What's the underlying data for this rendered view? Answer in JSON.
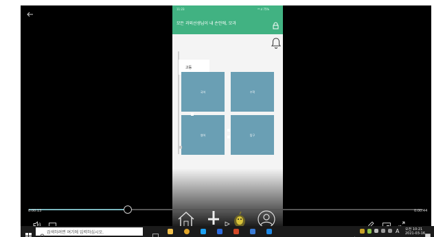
{
  "phone": {
    "status_time": "11:23",
    "status_right": "⁴ᴳ.ıl 75%",
    "header_title": "모든 과외선생님이 내 손안에, 모과",
    "tab_label": "고등",
    "tiles": [
      "국어",
      "수학",
      "영어",
      "탐구"
    ]
  },
  "player": {
    "elapsed": "0:00:13",
    "total": "0:00:44",
    "progress_fraction": 0.25
  },
  "taskbar": {
    "search_placeholder": "검색하려면 여기에 입력하십시오.",
    "ime": "A",
    "clock_time": "오전 10:21",
    "clock_date": "2021-03-16"
  },
  "colors": {
    "header_green": "#41b282",
    "tile_blue": "#6a9fb4",
    "progress_fill": "#7bb8c0"
  }
}
